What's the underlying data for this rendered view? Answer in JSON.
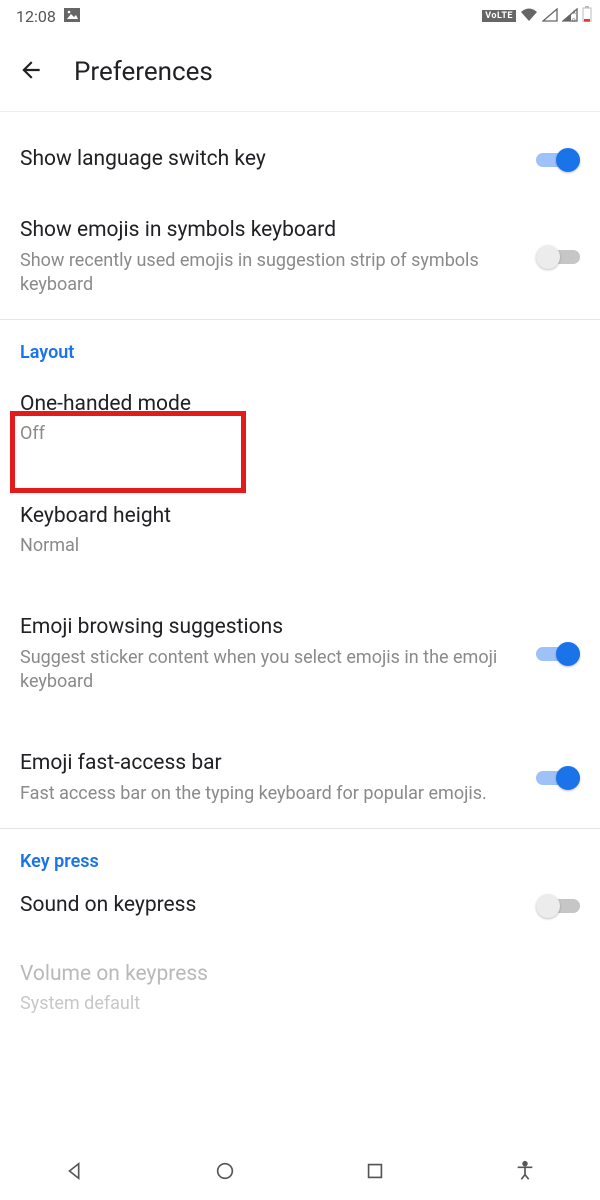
{
  "status": {
    "time": "12:08",
    "volte": "VoLTE"
  },
  "header": {
    "title": "Preferences"
  },
  "rows": {
    "lang_switch": {
      "title": "Show language switch key"
    },
    "emoji_symbols": {
      "title": "Show emojis in symbols keyboard",
      "sub": "Show recently used emojis in suggestion strip of symbols keyboard"
    },
    "layout_header": "Layout",
    "one_handed": {
      "title": "One-handed mode",
      "sub": "Off"
    },
    "kb_height": {
      "title": "Keyboard height",
      "sub": "Normal"
    },
    "emoji_browse": {
      "title": "Emoji browsing suggestions",
      "sub": "Suggest sticker content when you select emojis in the emoji keyboard"
    },
    "emoji_fast": {
      "title": "Emoji fast-access bar",
      "sub": "Fast access bar on the typing keyboard for popular emojis."
    },
    "keypress_header": "Key press",
    "sound": {
      "title": "Sound on keypress"
    },
    "volume": {
      "title": "Volume on keypress",
      "sub": "System default"
    }
  }
}
